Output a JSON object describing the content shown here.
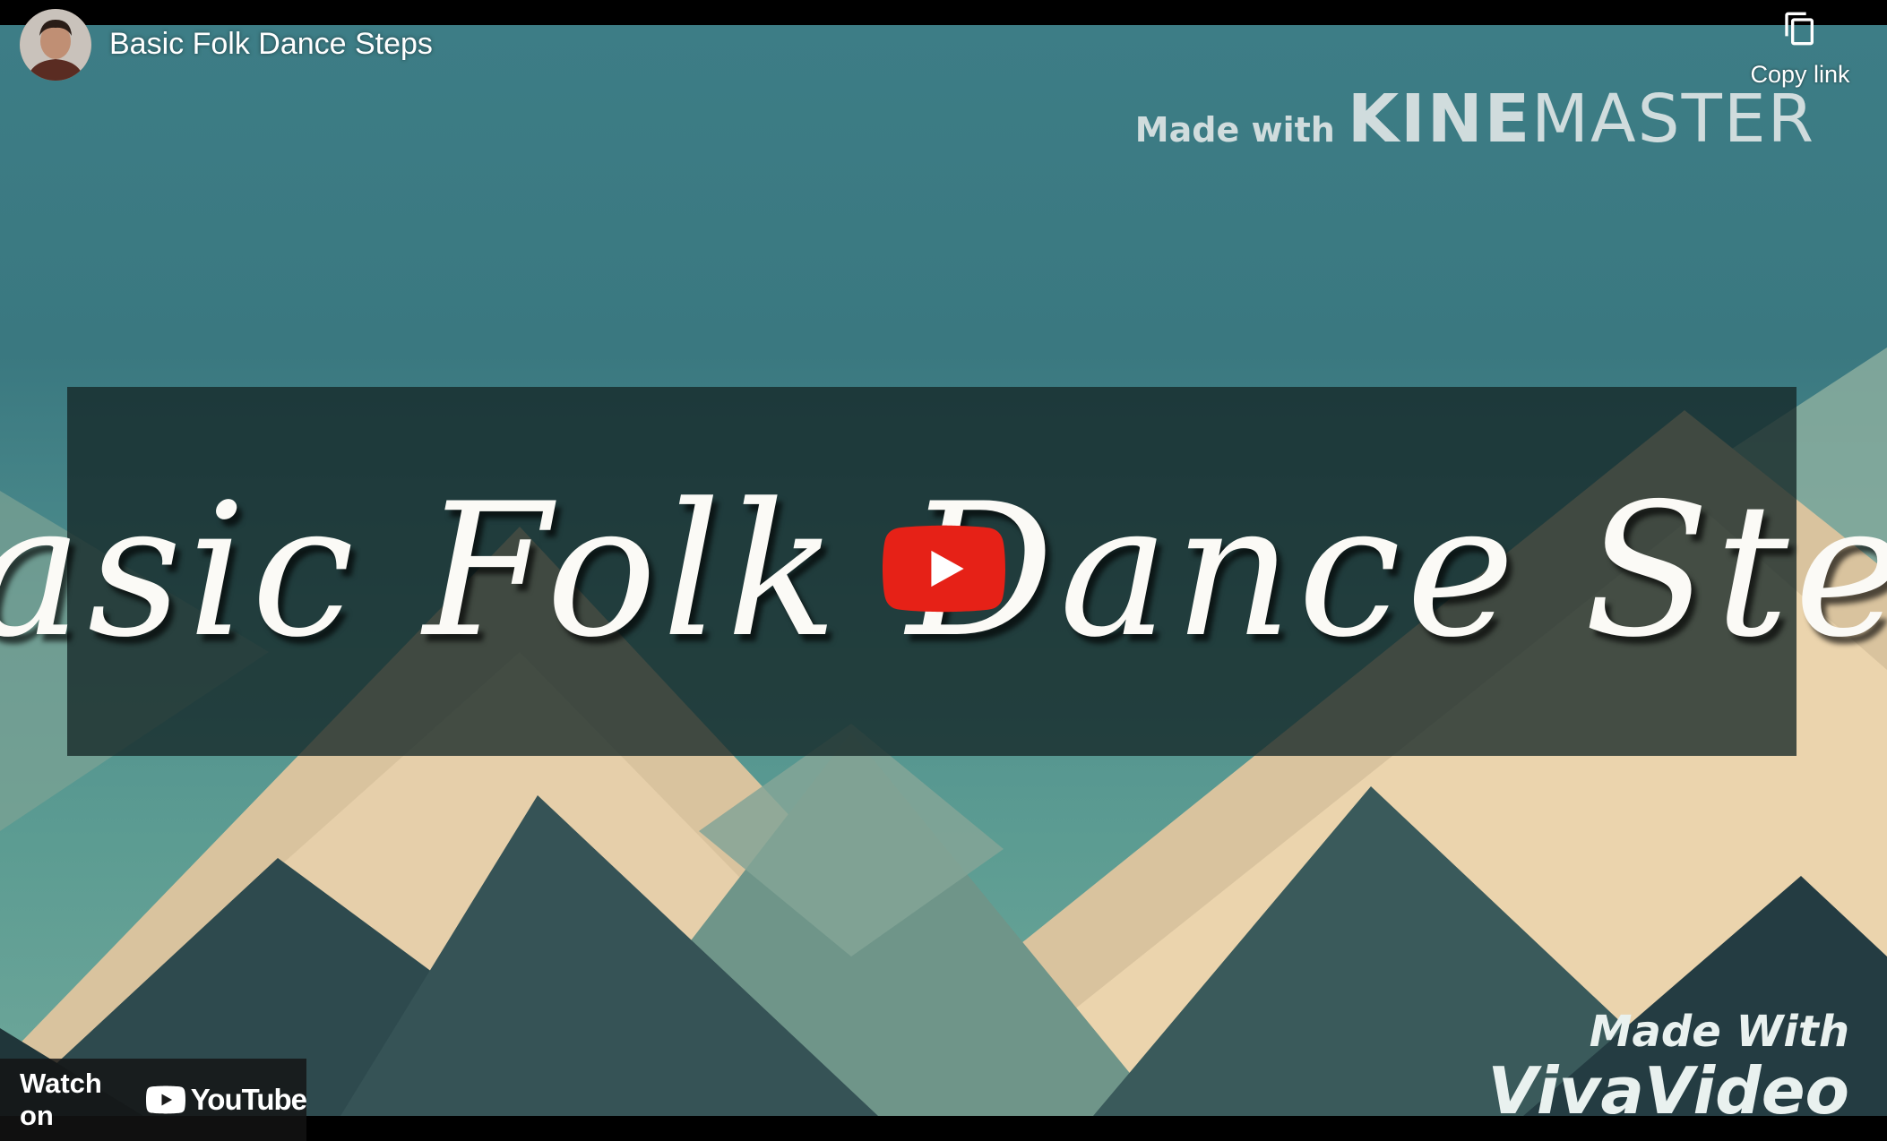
{
  "video": {
    "title": "Basic Folk Dance Steps",
    "thumbnail_text": "Basic Folk Dance Step",
    "watermark_top": {
      "prefix": "Made with",
      "brand_bold": "KINE",
      "brand_light": "MASTER"
    },
    "watermark_bottom": {
      "line1": "Made With",
      "line2": "VivaVideo"
    }
  },
  "controls": {
    "copy_link_label": "Copy link",
    "copy_icon": "copy-icon",
    "play_icon": "play-icon",
    "watch_on_label": "Watch on",
    "youtube_label": "YouTube"
  },
  "colors": {
    "play_red": "#e62117",
    "overlay_dark": "#1a1a1a"
  }
}
